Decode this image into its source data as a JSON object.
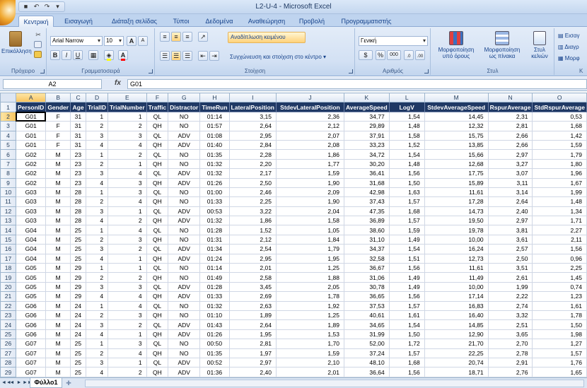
{
  "window": {
    "title": "L2-U-4 - Microsoft Excel"
  },
  "tabs": [
    "Κεντρική",
    "Εισαγωγή",
    "Διάταξη σελίδας",
    "Τύποι",
    "Δεδομένα",
    "Αναθεώρηση",
    "Προβολή",
    "Προγραμματιστής"
  ],
  "ribbon": {
    "clipboard": {
      "paste_label": "Επικόλληση",
      "group_label": "Πρόχειρο"
    },
    "font": {
      "font_name": "Arial Narrow",
      "font_size": "10",
      "group_label": "Γραμματοσειρά",
      "bold": "B",
      "italic": "I",
      "underline": "U",
      "grow": "A",
      "shrink": "A"
    },
    "alignment": {
      "wrap_label": "Αναδίπλωση κειμένου",
      "merge_label": "Συγχώνευση και στοίχιση στο κέντρο",
      "group_label": "Στοίχιση"
    },
    "number": {
      "format": "Γενική",
      "percent": "%",
      "thousands": "000",
      "group_label": "Αριθμός"
    },
    "styles": {
      "conditional_label": "Μορφοποίηση υπό όρους",
      "table_label": "Μορφοποίηση ως πίνακα",
      "cell_styles_label": "Στυλ κελιών",
      "group_label": "Στυλ"
    },
    "cells": {
      "insert_label": "Εισαγ",
      "delete_label": "Διαγρ",
      "format_label": "Μορφ",
      "group_label": "Κ"
    }
  },
  "formula_bar": {
    "name_box": "A2",
    "fx": "fx",
    "content": "G01"
  },
  "grid": {
    "columns": [
      "A",
      "B",
      "C",
      "D",
      "E",
      "F",
      "G",
      "H",
      "I",
      "J",
      "K",
      "L",
      "M",
      "N",
      "O"
    ],
    "headers": [
      "PersonID",
      "Gender",
      "Age",
      "TrialID",
      "TrialNumber",
      "Traffic",
      "Distractor",
      "TimeRun",
      "LateralPosition",
      "StdevLateralPosition",
      "AverageSpeed",
      "LogV",
      "StdevAverageSpeed",
      "RspurAverage",
      "StdRspurAverage"
    ],
    "row_numbers": [
      "1",
      "2",
      "3",
      "4",
      "5",
      "6",
      "7",
      "8",
      "9",
      "10",
      "11",
      "12",
      "13",
      "14",
      "15",
      "16",
      "17",
      "18",
      "19",
      "20",
      "21",
      "22",
      "23",
      "24",
      "25",
      "26",
      "27",
      "28",
      "29",
      "30"
    ],
    "rows": [
      [
        "G01",
        "F",
        "31",
        "1",
        "1",
        "QL",
        "NO",
        "01:14",
        "3,15",
        "2,36",
        "34,77",
        "1,54",
        "14,45",
        "2,31",
        "0,53"
      ],
      [
        "G01",
        "F",
        "31",
        "2",
        "2",
        "QH",
        "NO",
        "01:57",
        "2,64",
        "2,12",
        "29,89",
        "1,48",
        "12,32",
        "2,81",
        "1,68"
      ],
      [
        "G01",
        "F",
        "31",
        "3",
        "3",
        "QL",
        "ADV",
        "01:08",
        "2,95",
        "2,07",
        "37,91",
        "1,58",
        "15,75",
        "2,66",
        "1,42"
      ],
      [
        "G01",
        "F",
        "31",
        "4",
        "4",
        "QH",
        "ADV",
        "01:40",
        "2,84",
        "2,08",
        "33,23",
        "1,52",
        "13,85",
        "2,66",
        "1,59"
      ],
      [
        "G02",
        "M",
        "23",
        "1",
        "2",
        "QL",
        "NO",
        "01:35",
        "2,28",
        "1,86",
        "34,72",
        "1,54",
        "15,66",
        "2,97",
        "1,79"
      ],
      [
        "G02",
        "M",
        "23",
        "2",
        "1",
        "QH",
        "NO",
        "01:32",
        "2,20",
        "1,77",
        "30,20",
        "1,48",
        "12,68",
        "3,27",
        "1,80"
      ],
      [
        "G02",
        "M",
        "23",
        "3",
        "4",
        "QL",
        "ADV",
        "01:32",
        "2,17",
        "1,59",
        "36,41",
        "1,56",
        "17,75",
        "3,07",
        "1,96"
      ],
      [
        "G02",
        "M",
        "23",
        "4",
        "3",
        "QH",
        "ADV",
        "01:26",
        "2,50",
        "1,90",
        "31,68",
        "1,50",
        "15,89",
        "3,11",
        "1,67"
      ],
      [
        "G03",
        "M",
        "28",
        "1",
        "3",
        "QL",
        "NO",
        "01:00",
        "2,46",
        "2,09",
        "42,98",
        "1,63",
        "11,61",
        "3,14",
        "1,99"
      ],
      [
        "G03",
        "M",
        "28",
        "2",
        "4",
        "QH",
        "NO",
        "01:33",
        "2,25",
        "1,90",
        "37,43",
        "1,57",
        "17,28",
        "2,64",
        "1,48"
      ],
      [
        "G03",
        "M",
        "28",
        "3",
        "1",
        "QL",
        "ADV",
        "00:53",
        "3,22",
        "2,04",
        "47,35",
        "1,68",
        "14,73",
        "2,40",
        "1,34"
      ],
      [
        "G03",
        "M",
        "28",
        "4",
        "2",
        "QH",
        "ADV",
        "01:32",
        "1,86",
        "1,58",
        "36,89",
        "1,57",
        "19,50",
        "2,97",
        "1,71"
      ],
      [
        "G04",
        "M",
        "25",
        "1",
        "4",
        "QL",
        "NO",
        "01:28",
        "1,52",
        "1,05",
        "38,60",
        "1,59",
        "19,78",
        "3,81",
        "2,27"
      ],
      [
        "G04",
        "M",
        "25",
        "2",
        "3",
        "QH",
        "NO",
        "01:31",
        "2,12",
        "1,84",
        "31,10",
        "1,49",
        "10,00",
        "3,61",
        "2,11"
      ],
      [
        "G04",
        "M",
        "25",
        "3",
        "2",
        "QL",
        "ADV",
        "01:34",
        "2,54",
        "1,79",
        "34,37",
        "1,54",
        "16,24",
        "2,57",
        "1,56"
      ],
      [
        "G04",
        "M",
        "25",
        "4",
        "1",
        "QH",
        "ADV",
        "01:24",
        "2,95",
        "1,95",
        "32,58",
        "1,51",
        "12,73",
        "2,50",
        "0,96"
      ],
      [
        "G05",
        "M",
        "29",
        "1",
        "1",
        "QL",
        "NO",
        "01:14",
        "2,01",
        "1,25",
        "36,67",
        "1,56",
        "11,61",
        "3,51",
        "2,25"
      ],
      [
        "G05",
        "M",
        "29",
        "2",
        "2",
        "QH",
        "NO",
        "01:49",
        "2,58",
        "1,88",
        "31,06",
        "1,49",
        "11,49",
        "2,61",
        "1,45"
      ],
      [
        "G05",
        "M",
        "29",
        "3",
        "3",
        "QL",
        "ADV",
        "01:28",
        "3,45",
        "2,05",
        "30,78",
        "1,49",
        "10,00",
        "1,99",
        "0,74"
      ],
      [
        "G05",
        "M",
        "29",
        "4",
        "4",
        "QH",
        "ADV",
        "01:33",
        "2,69",
        "1,78",
        "36,65",
        "1,56",
        "17,14",
        "2,22",
        "1,23"
      ],
      [
        "G06",
        "M",
        "24",
        "1",
        "4",
        "QL",
        "NO",
        "01:32",
        "2,63",
        "1,92",
        "37,53",
        "1,57",
        "16,83",
        "2,74",
        "1,61"
      ],
      [
        "G06",
        "M",
        "24",
        "2",
        "3",
        "QH",
        "NO",
        "01:10",
        "1,89",
        "1,25",
        "40,61",
        "1,61",
        "16,40",
        "3,32",
        "1,78"
      ],
      [
        "G06",
        "M",
        "24",
        "3",
        "2",
        "QL",
        "ADV",
        "01:43",
        "2,64",
        "1,89",
        "34,65",
        "1,54",
        "14,85",
        "2,51",
        "1,50"
      ],
      [
        "G06",
        "M",
        "24",
        "4",
        "1",
        "QH",
        "ADV",
        "01:26",
        "1,95",
        "1,53",
        "31,99",
        "1,50",
        "12,90",
        "3,65",
        "1,98"
      ],
      [
        "G07",
        "M",
        "25",
        "1",
        "3",
        "QL",
        "NO",
        "00:50",
        "2,81",
        "1,70",
        "52,00",
        "1,72",
        "21,70",
        "2,70",
        "1,27"
      ],
      [
        "G07",
        "M",
        "25",
        "2",
        "4",
        "QH",
        "NO",
        "01:35",
        "1,97",
        "1,59",
        "37,24",
        "1,57",
        "22,25",
        "2,78",
        "1,57"
      ],
      [
        "G07",
        "M",
        "25",
        "3",
        "1",
        "QL",
        "ADV",
        "00:52",
        "2,97",
        "2,10",
        "48,10",
        "1,68",
        "20,74",
        "2,91",
        "1,76"
      ],
      [
        "G07",
        "M",
        "25",
        "4",
        "2",
        "QH",
        "ADV",
        "01:36",
        "2,40",
        "2,01",
        "36,64",
        "1,56",
        "18,71",
        "2,76",
        "1,65"
      ],
      [
        "G08",
        "M",
        "25",
        "1",
        "2",
        "QL",
        "NO",
        "01:16",
        "2,48",
        "1,77",
        "45,94",
        "1,66",
        "19,64",
        "2,62",
        "1,60"
      ]
    ]
  },
  "sheets": {
    "active": "Φύλλο1",
    "nav": [
      "◄◄",
      "◄",
      "►",
      "►►"
    ]
  }
}
